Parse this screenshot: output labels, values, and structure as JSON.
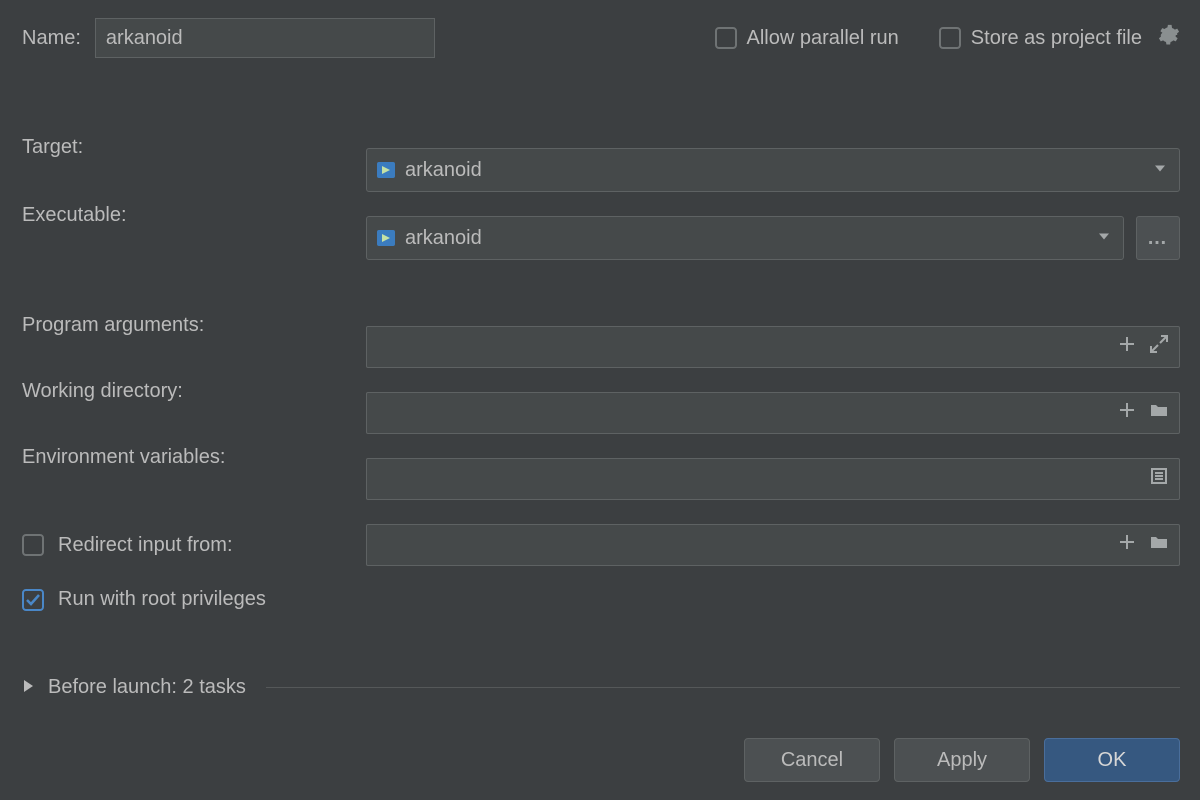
{
  "top": {
    "name_label": "Name:",
    "name_value": "arkanoid",
    "allow_parallel": {
      "label": "Allow parallel run",
      "checked": false
    },
    "store_as_project": {
      "label": "Store as project file",
      "checked": false
    }
  },
  "fields": {
    "target": {
      "label": "Target:",
      "value": "arkanoid"
    },
    "executable": {
      "label": "Executable:",
      "value": "arkanoid"
    },
    "program_args": {
      "label": "Program arguments:",
      "value": ""
    },
    "working_dir": {
      "label": "Working directory:",
      "value": ""
    },
    "env_vars": {
      "label": "Environment variables:",
      "value": ""
    },
    "redirect_input": {
      "label": "Redirect input from:",
      "checked": false,
      "value": ""
    },
    "root_priv": {
      "label": "Run with root privileges",
      "checked": true
    }
  },
  "before_launch": {
    "label": "Before launch: 2 tasks"
  },
  "buttons": {
    "cancel": "Cancel",
    "apply": "Apply",
    "ok": "OK"
  }
}
